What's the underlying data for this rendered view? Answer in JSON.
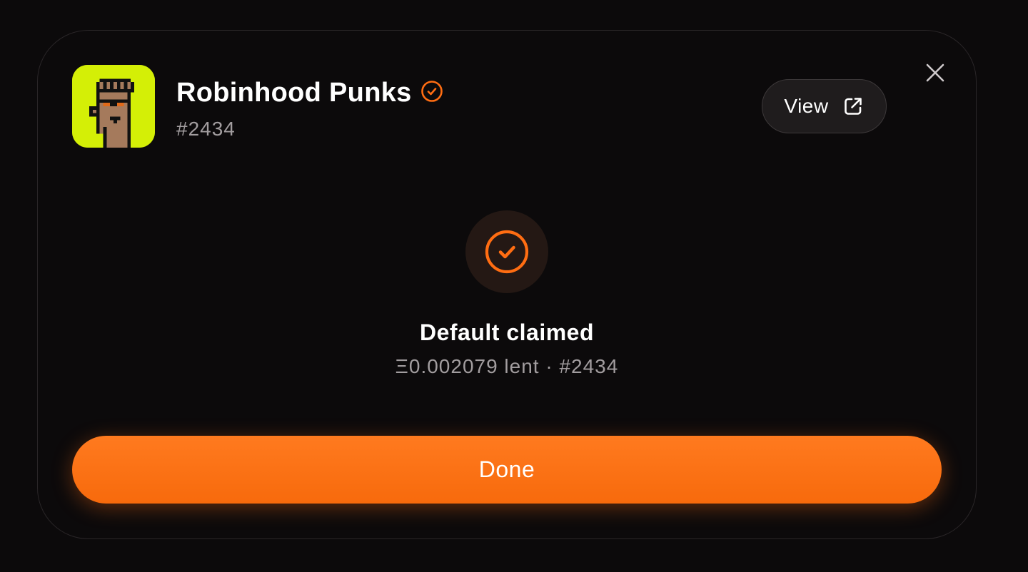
{
  "nft": {
    "collection_name": "Robinhood Punks",
    "token_id": "#2434",
    "avatar_icon": "pixel-punk-avatar",
    "verified_icon": "verified-check-icon"
  },
  "header": {
    "view_label": "View",
    "view_icon": "external-link-icon",
    "close_icon": "close-icon"
  },
  "status": {
    "icon": "check-circle-icon",
    "title": "Default claimed",
    "subtitle": "Ξ0.002079 lent · #2434"
  },
  "actions": {
    "done_label": "Done"
  },
  "colors": {
    "accent": "#ff7a1f",
    "avatar_bg": "#d4ef06",
    "background": "#0c0a0b"
  }
}
